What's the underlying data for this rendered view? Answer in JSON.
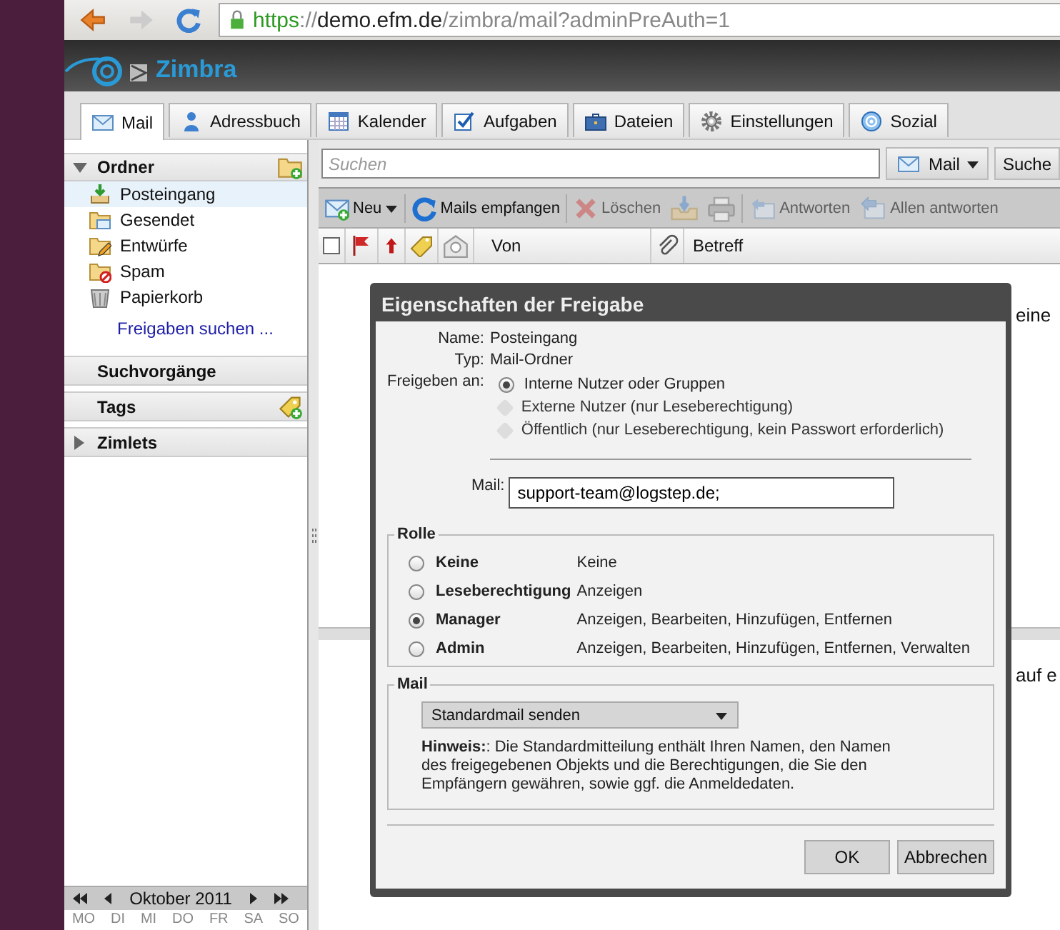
{
  "browser": {
    "url": {
      "scheme": "https",
      "separator": "://",
      "host": "demo.efm.de",
      "path": "/zimbra/mail?adminPreAuth=1"
    }
  },
  "logo": {
    "text": "Zimbra"
  },
  "app_tabs": [
    {
      "label": "Mail",
      "selected": true
    },
    {
      "label": "Adressbuch",
      "selected": false
    },
    {
      "label": "Kalender",
      "selected": false
    },
    {
      "label": "Aufgaben",
      "selected": false
    },
    {
      "label": "Dateien",
      "selected": false
    },
    {
      "label": "Einstellungen",
      "selected": false
    },
    {
      "label": "Sozial",
      "selected": false
    }
  ],
  "search": {
    "placeholder": "Suchen",
    "scope": "Mail",
    "button": "Suche"
  },
  "toolbar": [
    {
      "kind": "menu",
      "label": "Neu",
      "disabled": false
    },
    {
      "kind": "button",
      "label": "Mails empfangen",
      "disabled": false
    },
    {
      "kind": "button",
      "label": "Löschen",
      "disabled": true
    },
    {
      "kind": "icon",
      "disabled": true
    },
    {
      "kind": "icon",
      "disabled": true
    },
    {
      "kind": "button",
      "label": "Antworten",
      "disabled": true
    },
    {
      "kind": "button",
      "label": "Allen antworten",
      "disabled": true
    }
  ],
  "list_columns": {
    "select_all": {
      "checked": false
    },
    "from": "Von",
    "subject": "Betreff"
  },
  "list_pane": {
    "text": "eine"
  },
  "reading_pane": {
    "text": "auf e"
  },
  "sidebar": {
    "header": {
      "label": "Ordner",
      "expanded": true
    },
    "folders": [
      {
        "label": "Posteingang",
        "selected": true
      },
      {
        "label": "Gesendet",
        "selected": false
      },
      {
        "label": "Entwürfe",
        "selected": false
      },
      {
        "label": "Spam",
        "selected": false
      },
      {
        "label": "Papierkorb",
        "selected": false
      }
    ],
    "link": "Freigaben suchen ...",
    "sections": [
      {
        "kind": "plain",
        "label": "Suchvorgänge"
      },
      {
        "kind": "tags",
        "label": "Tags"
      },
      {
        "kind": "tree",
        "label": "Zimlets",
        "expanded": false
      }
    ]
  },
  "mini_calendar": {
    "month": "Oktober 2011",
    "weekdays": [
      "MO",
      "DI",
      "MI",
      "DO",
      "FR",
      "SA",
      "SO"
    ]
  },
  "dialog": {
    "title": "Eigenschaften der Freigabe",
    "name_label": "Name:",
    "name": "Posteingang",
    "type_label": "Typ:",
    "type": "Mail-Ordner",
    "share_with_label": "Freigeben an:",
    "share_with": [
      {
        "label": "Interne Nutzer oder Gruppen",
        "selected": true,
        "disabled": false
      },
      {
        "label": "Externe Nutzer (nur Leseberechtigung)",
        "selected": false,
        "disabled": true
      },
      {
        "label": "Öffentlich (nur Leseberechtigung, kein Passwort erforderlich)",
        "selected": false,
        "disabled": true
      }
    ],
    "mail_label": "Mail:",
    "mail_value": "support-team@logstep.de;",
    "role_legend": "Rolle",
    "roles": [
      {
        "name": "Keine",
        "rights": "Keine",
        "selected": false
      },
      {
        "name": "Leseberechtigung",
        "rights": "Anzeigen",
        "selected": false
      },
      {
        "name": "Manager",
        "rights": "Anzeigen, Bearbeiten, Hinzufügen, Entfernen",
        "selected": true
      },
      {
        "name": "Admin",
        "rights": "Anzeigen, Bearbeiten, Hinzufügen, Entfernen, Verwalten",
        "selected": false
      }
    ],
    "mail_legend": "Mail",
    "mail_option": "Standardmail senden",
    "hint": "**Hinweis:**: Die Standardmitteilung enthält Ihren Namen, den Namen des freigegebenen Objekts und die Berechtigungen, die Sie den Empfängern gewähren, sowie ggf. die Anmeldedaten.",
    "buttons": [
      "OK",
      "Abbrechen"
    ]
  }
}
